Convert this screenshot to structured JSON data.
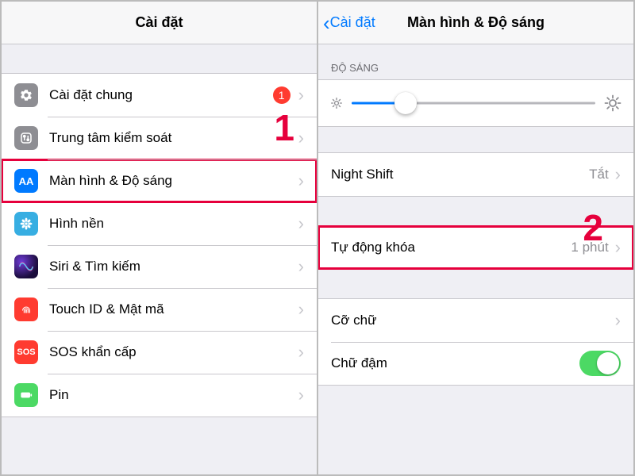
{
  "left": {
    "title": "Cài đặt",
    "items": [
      {
        "key": "general",
        "label": "Cài đặt chung",
        "badge": "1"
      },
      {
        "key": "control",
        "label": "Trung tâm kiểm soát"
      },
      {
        "key": "display",
        "label": "Màn hình & Độ sáng",
        "highlight": true
      },
      {
        "key": "wallpaper",
        "label": "Hình nền"
      },
      {
        "key": "siri",
        "label": "Siri & Tìm kiếm"
      },
      {
        "key": "touchid",
        "label": "Touch ID & Mật mã"
      },
      {
        "key": "sos",
        "label": "SOS khẩn cấp"
      },
      {
        "key": "battery",
        "label": "Pin"
      }
    ],
    "annot": "1"
  },
  "right": {
    "back": "Cài đặt",
    "title": "Màn hình & Độ sáng",
    "brightness_header": "ĐỘ SÁNG",
    "night_shift": {
      "label": "Night Shift",
      "value": "Tắt"
    },
    "auto_lock": {
      "label": "Tự động khóa",
      "value": "1 phút",
      "highlight": true
    },
    "text_size": {
      "label": "Cỡ chữ"
    },
    "bold_text": {
      "label": "Chữ đậm",
      "on": true
    },
    "annot": "2"
  },
  "icons": {
    "display_text": "AA",
    "sos_text": "SOS"
  }
}
